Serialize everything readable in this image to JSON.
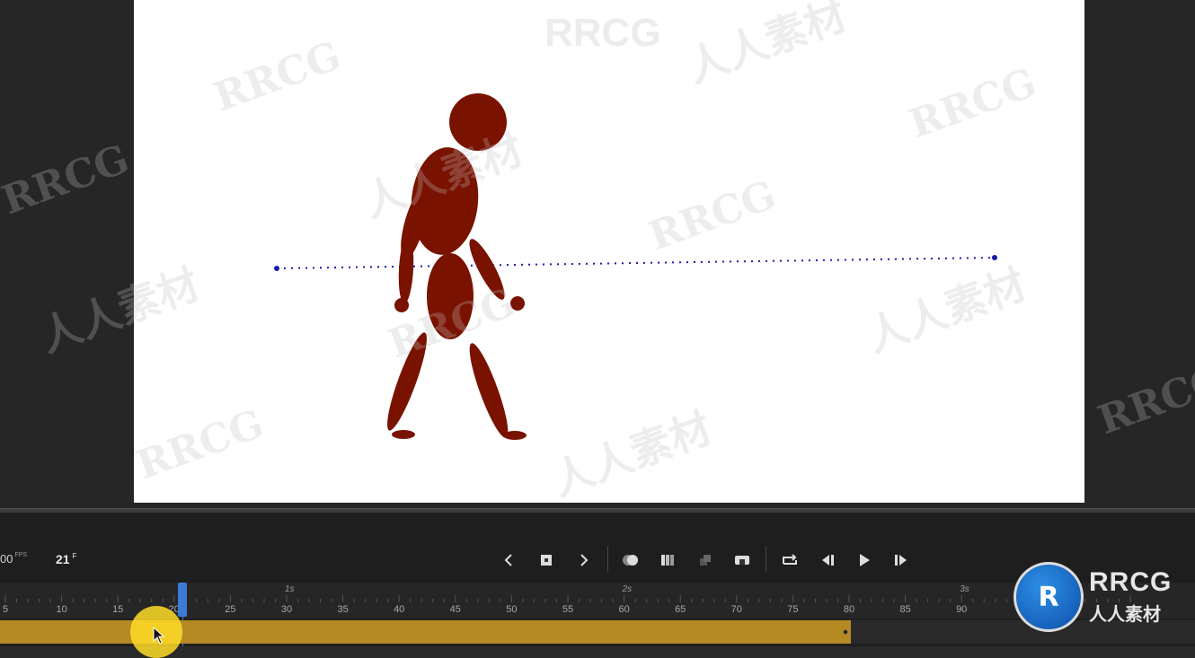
{
  "timeline": {
    "fps_value": "00",
    "fps_unit": "FPS",
    "current_frame": "21",
    "frame_unit": "F",
    "ruler_ticks": [
      "5",
      "10",
      "15",
      "20",
      "25",
      "30",
      "35",
      "40",
      "45",
      "50",
      "55",
      "60",
      "65",
      "70",
      "75",
      "80",
      "85",
      "90"
    ],
    "seconds_labels": [
      "1s",
      "2s",
      "3s"
    ],
    "playhead_frame": 21,
    "layer_span_end_frame": 80
  },
  "controls": {
    "prev_keyframe": "chevron-left-icon",
    "insert_keyframe": "keyframe-icon",
    "next_keyframe": "chevron-right-icon",
    "onion_skin": "onion-skin-icon",
    "edit_multiple_frames": "multi-frame-icon",
    "center_frame": "center-icon",
    "camera": "camera-icon",
    "loop": "loop-icon",
    "step_back": "step-back-icon",
    "play": "play-icon",
    "step_forward": "step-forward-icon"
  },
  "watermarks": {
    "top_text": "RRCG",
    "latin_text": "RRCG",
    "cn_text": "人人素材"
  },
  "logo": {
    "brand": "RRCG",
    "sub": "人人素材",
    "mark": "R"
  },
  "colors": {
    "figure": "#7a1200",
    "motion_path": "#1a1aa8",
    "playhead": "#3d7bd9",
    "layer_span": "#b58a24"
  }
}
